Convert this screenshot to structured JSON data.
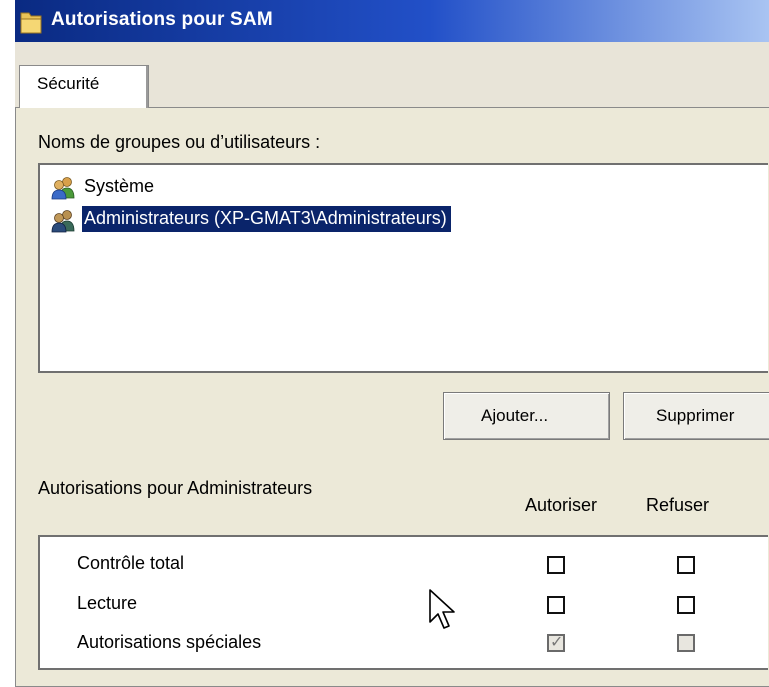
{
  "window": {
    "title": "Autorisations pour SAM",
    "icon": "folder-icon"
  },
  "tabs": [
    {
      "label": "Sécurité"
    }
  ],
  "groups": {
    "label": "Noms de groupes ou d’utilisateurs :",
    "items": [
      {
        "label": "Système",
        "icon": "users-icon"
      },
      {
        "label": "Administrateurs (XP-GMAT3\\Administrateurs)",
        "icon": "users-icon",
        "selected": true
      }
    ]
  },
  "buttons": {
    "add": "Ajouter...",
    "remove": "Supprimer"
  },
  "permissions": {
    "title": "Autorisations pour Administrateurs",
    "col_allow": "Autoriser",
    "col_deny": "Refuser",
    "rows": [
      {
        "name": "Contrôle total",
        "allow": false,
        "deny": false
      },
      {
        "name": "Lecture",
        "allow": false,
        "deny": false
      },
      {
        "name": "Autorisations spéciales",
        "allow": true,
        "deny": false,
        "disabled": true
      }
    ]
  },
  "colors": {
    "title_start": "#0a2a82",
    "selection": "#0a246a",
    "dialog_bg": "#ece9d8"
  }
}
